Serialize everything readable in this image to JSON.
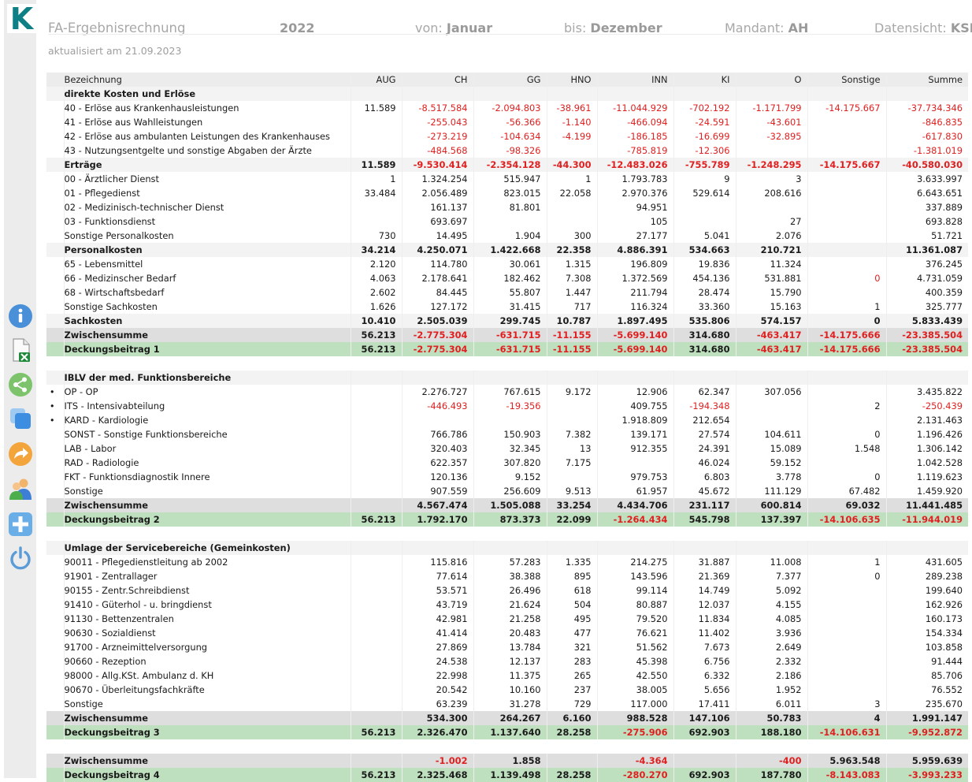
{
  "app": {
    "logo_letter": "K",
    "accent": "#0f7f86"
  },
  "header": {
    "title": "FA-Ergebnisrechnung",
    "year": "2022",
    "from_label": "von:",
    "from_value": "Januar",
    "to_label": "bis:",
    "to_value": "Dezember",
    "client_label": "Mandant:",
    "client_value": "AH",
    "view_label": "Datensicht:",
    "view_value": "KSR",
    "updated": "aktualisiert am 21.09.2023"
  },
  "sidebar": {
    "icons": [
      "info-icon",
      "excel-export-icon",
      "share-icon",
      "copy-icon",
      "forward-icon",
      "users-icon",
      "add-icon",
      "power-icon"
    ]
  },
  "table": {
    "columns": [
      "Bezeichnung",
      "AUG",
      "CH",
      "GG",
      "HNO",
      "INN",
      "KI",
      "O",
      "Sonstige",
      "Summe"
    ],
    "rows": [
      {
        "t": "sec",
        "label": "direkte Kosten und Erlöse",
        "v": [
          "",
          "",
          "",
          "",
          "",
          "",
          "",
          "",
          ""
        ]
      },
      {
        "t": "row",
        "label": "40 - Erlöse aus Krankenhausleistungen",
        "v": [
          "11.589",
          "-8.517.584",
          "-2.094.803",
          "-38.961",
          "-11.044.929",
          "-702.192",
          "-1.171.799",
          "-14.175.667",
          "-37.734.346"
        ]
      },
      {
        "t": "row",
        "label": "41 - Erlöse aus Wahlleistungen",
        "v": [
          "",
          "-255.043",
          "-56.366",
          "-1.140",
          "-466.094",
          "-24.591",
          "-43.601",
          "",
          "-846.835"
        ]
      },
      {
        "t": "row",
        "label": "42 - Erlöse aus ambulanten Leistungen des Krankenhauses",
        "v": [
          "",
          "-273.219",
          "-104.634",
          "-4.199",
          "-186.185",
          "-16.699",
          "-32.895",
          "",
          "-617.830"
        ]
      },
      {
        "t": "row",
        "label": "43 - Nutzungsentgelte und sonstige Abgaben der Ärzte",
        "v": [
          "",
          "-484.568",
          "-98.326",
          "",
          "-785.819",
          "-12.306",
          "",
          "",
          "-1.381.019"
        ]
      },
      {
        "t": "sum",
        "label": "Erträge",
        "v": [
          "11.589",
          "-9.530.414",
          "-2.354.128",
          "-44.300",
          "-12.483.026",
          "-755.789",
          "-1.248.295",
          "-14.175.667",
          "-40.580.030"
        ]
      },
      {
        "t": "row",
        "label": "00 - Ärztlicher Dienst",
        "v": [
          "1",
          "1.324.254",
          "515.947",
          "1",
          "1.793.783",
          "9",
          "3",
          "",
          "3.633.997"
        ]
      },
      {
        "t": "row",
        "label": "01 - Pflegedienst",
        "v": [
          "33.484",
          "2.056.489",
          "823.015",
          "22.058",
          "2.970.376",
          "529.614",
          "208.616",
          "",
          "6.643.651"
        ]
      },
      {
        "t": "row",
        "label": "02 - Medizinisch-technischer Dienst",
        "v": [
          "",
          "161.137",
          "81.801",
          "",
          "94.951",
          "",
          "",
          "",
          "337.889"
        ]
      },
      {
        "t": "row",
        "label": "03 - Funktionsdienst",
        "v": [
          "",
          "693.697",
          "",
          "",
          "105",
          "",
          "27",
          "",
          "693.828"
        ]
      },
      {
        "t": "row",
        "label": "Sonstige Personalkosten",
        "v": [
          "730",
          "14.495",
          "1.904",
          "300",
          "27.177",
          "5.041",
          "2.076",
          "",
          "51.721"
        ]
      },
      {
        "t": "sum",
        "label": "Personalkosten",
        "v": [
          "34.214",
          "4.250.071",
          "1.422.668",
          "22.358",
          "4.886.391",
          "534.663",
          "210.721",
          "",
          "11.361.087"
        ]
      },
      {
        "t": "row",
        "label": "65 - Lebensmittel",
        "v": [
          "2.120",
          "114.780",
          "30.061",
          "1.315",
          "196.809",
          "19.836",
          "11.324",
          "",
          "376.245"
        ]
      },
      {
        "t": "row",
        "label": "66 - Medizinscher Bedarf",
        "v": [
          "4.063",
          "2.178.641",
          "182.462",
          "7.308",
          "1.372.569",
          "454.136",
          "531.881",
          "0",
          "4.731.059"
        ],
        "red": [
          7
        ]
      },
      {
        "t": "row",
        "label": "68 - Wirtschaftsbedarf",
        "v": [
          "2.602",
          "84.445",
          "55.807",
          "1.447",
          "211.794",
          "28.474",
          "15.790",
          "",
          "400.359"
        ]
      },
      {
        "t": "row",
        "label": "Sonstige Sachkosten",
        "v": [
          "1.626",
          "127.172",
          "31.415",
          "717",
          "116.324",
          "33.360",
          "15.163",
          "1",
          "325.777"
        ]
      },
      {
        "t": "sum",
        "label": "Sachkosten",
        "v": [
          "10.410",
          "2.505.039",
          "299.745",
          "10.787",
          "1.897.495",
          "535.806",
          "574.157",
          "0",
          "5.833.439"
        ]
      },
      {
        "t": "zw",
        "label": "Zwischensumme",
        "v": [
          "56.213",
          "-2.775.304",
          "-631.715",
          "-11.155",
          "-5.699.140",
          "314.680",
          "-463.417",
          "-14.175.666",
          "-23.385.504"
        ]
      },
      {
        "t": "db",
        "label": "Deckungsbeitrag 1",
        "v": [
          "56.213",
          "-2.775.304",
          "-631.715",
          "-11.155",
          "-5.699.140",
          "314.680",
          "-463.417",
          "-14.175.666",
          "-23.385.504"
        ]
      },
      {
        "t": "gap"
      },
      {
        "t": "sec",
        "label": "IBLV der med. Funktionsbereiche",
        "v": [
          "",
          "",
          "",
          "",
          "",
          "",
          "",
          "",
          ""
        ]
      },
      {
        "t": "row",
        "bullet": true,
        "label": "OP - OP",
        "v": [
          "",
          "2.276.727",
          "767.615",
          "9.172",
          "12.906",
          "62.347",
          "307.056",
          "",
          "3.435.822"
        ]
      },
      {
        "t": "row",
        "bullet": true,
        "label": "ITS - Intensivabteilung",
        "v": [
          "",
          "-446.493",
          "-19.356",
          "",
          "409.755",
          "-194.348",
          "",
          "2",
          "-250.439"
        ]
      },
      {
        "t": "row",
        "bullet": true,
        "label": "KARD - Kardiologie",
        "v": [
          "",
          "",
          "",
          "",
          "1.918.809",
          "212.654",
          "",
          "",
          "2.131.463"
        ]
      },
      {
        "t": "row",
        "label": "SONST - Sonstige Funktionsbereiche",
        "v": [
          "",
          "766.786",
          "150.903",
          "7.382",
          "139.171",
          "27.574",
          "104.611",
          "0",
          "1.196.426"
        ]
      },
      {
        "t": "row",
        "label": "LAB - Labor",
        "v": [
          "",
          "320.403",
          "32.345",
          "13",
          "912.355",
          "24.391",
          "15.089",
          "1.548",
          "1.306.142"
        ]
      },
      {
        "t": "row",
        "label": "RAD - Radiologie",
        "v": [
          "",
          "622.357",
          "307.820",
          "7.175",
          "",
          "46.024",
          "59.152",
          "",
          "1.042.528"
        ]
      },
      {
        "t": "row",
        "label": "FKT - Funktionsdiagnostik Innere",
        "v": [
          "",
          "120.136",
          "9.152",
          "",
          "979.753",
          "6.803",
          "3.778",
          "0",
          "1.119.623"
        ]
      },
      {
        "t": "row",
        "label": "Sonstige",
        "v": [
          "",
          "907.559",
          "256.609",
          "9.513",
          "61.957",
          "45.672",
          "111.129",
          "67.482",
          "1.459.920"
        ]
      },
      {
        "t": "zw",
        "label": "Zwischensumme",
        "v": [
          "",
          "4.567.474",
          "1.505.088",
          "33.254",
          "4.434.706",
          "231.117",
          "600.814",
          "69.032",
          "11.441.485"
        ]
      },
      {
        "t": "db",
        "label": "Deckungsbeitrag 2",
        "v": [
          "56.213",
          "1.792.170",
          "873.373",
          "22.099",
          "-1.264.434",
          "545.798",
          "137.397",
          "-14.106.635",
          "-11.944.019"
        ]
      },
      {
        "t": "gap"
      },
      {
        "t": "sec",
        "label": "Umlage der Servicebereiche (Gemeinkosten)",
        "v": [
          "",
          "",
          "",
          "",
          "",
          "",
          "",
          "",
          ""
        ]
      },
      {
        "t": "row",
        "label": "90011 - Pflegedienstleitung ab 2002",
        "v": [
          "",
          "115.816",
          "57.283",
          "1.335",
          "214.275",
          "31.887",
          "11.008",
          "1",
          "431.605"
        ]
      },
      {
        "t": "row",
        "label": "91901 - Zentrallager",
        "v": [
          "",
          "77.614",
          "38.388",
          "895",
          "143.596",
          "21.369",
          "7.377",
          "0",
          "289.238"
        ]
      },
      {
        "t": "row",
        "label": "90155 - Zentr.Schreibdienst",
        "v": [
          "",
          "53.571",
          "26.496",
          "618",
          "99.114",
          "14.749",
          "5.092",
          "",
          "199.640"
        ]
      },
      {
        "t": "row",
        "label": "91410 - Güterhol - u. bringdienst",
        "v": [
          "",
          "43.719",
          "21.624",
          "504",
          "80.887",
          "12.037",
          "4.155",
          "",
          "162.926"
        ]
      },
      {
        "t": "row",
        "label": "91130 - Bettenzentralen",
        "v": [
          "",
          "42.981",
          "21.258",
          "495",
          "79.520",
          "11.834",
          "4.085",
          "",
          "160.173"
        ]
      },
      {
        "t": "row",
        "label": "90630 - Sozialdienst",
        "v": [
          "",
          "41.414",
          "20.483",
          "477",
          "76.621",
          "11.402",
          "3.936",
          "",
          "154.334"
        ]
      },
      {
        "t": "row",
        "label": "91700 - Arzneimittelversorgung",
        "v": [
          "",
          "27.869",
          "13.784",
          "321",
          "51.562",
          "7.673",
          "2.649",
          "",
          "103.858"
        ]
      },
      {
        "t": "row",
        "label": "90660 - Rezeption",
        "v": [
          "",
          "24.538",
          "12.137",
          "283",
          "45.398",
          "6.756",
          "2.332",
          "",
          "91.444"
        ]
      },
      {
        "t": "row",
        "label": "98000 - Allg.KSt. Ambulanz d. KH",
        "v": [
          "",
          "22.998",
          "11.375",
          "265",
          "42.550",
          "6.332",
          "2.186",
          "",
          "85.706"
        ]
      },
      {
        "t": "row",
        "label": "90670 - Überleitungsfachkräfte",
        "v": [
          "",
          "20.542",
          "10.160",
          "237",
          "38.005",
          "5.656",
          "1.952",
          "",
          "76.552"
        ]
      },
      {
        "t": "row",
        "label": "Sonstige",
        "v": [
          "",
          "63.239",
          "31.278",
          "729",
          "117.000",
          "17.411",
          "6.011",
          "3",
          "235.670"
        ]
      },
      {
        "t": "zw",
        "label": "Zwischensumme",
        "v": [
          "",
          "534.300",
          "264.267",
          "6.160",
          "988.528",
          "147.106",
          "50.783",
          "4",
          "1.991.147"
        ]
      },
      {
        "t": "db",
        "label": "Deckungsbeitrag 3",
        "v": [
          "56.213",
          "2.326.470",
          "1.137.640",
          "28.258",
          "-275.906",
          "692.903",
          "188.180",
          "-14.106.631",
          "-9.952.872"
        ]
      },
      {
        "t": "gap"
      },
      {
        "t": "zw",
        "label": "Zwischensumme",
        "v": [
          "",
          "-1.002",
          "1.858",
          "",
          "-4.364",
          "",
          "-400",
          "5.963.548",
          "5.959.639"
        ]
      },
      {
        "t": "db",
        "label": "Deckungsbeitrag 4",
        "v": [
          "56.213",
          "2.325.468",
          "1.139.498",
          "28.258",
          "-280.270",
          "692.903",
          "187.780",
          "-8.143.083",
          "-3.993.233"
        ]
      }
    ]
  }
}
